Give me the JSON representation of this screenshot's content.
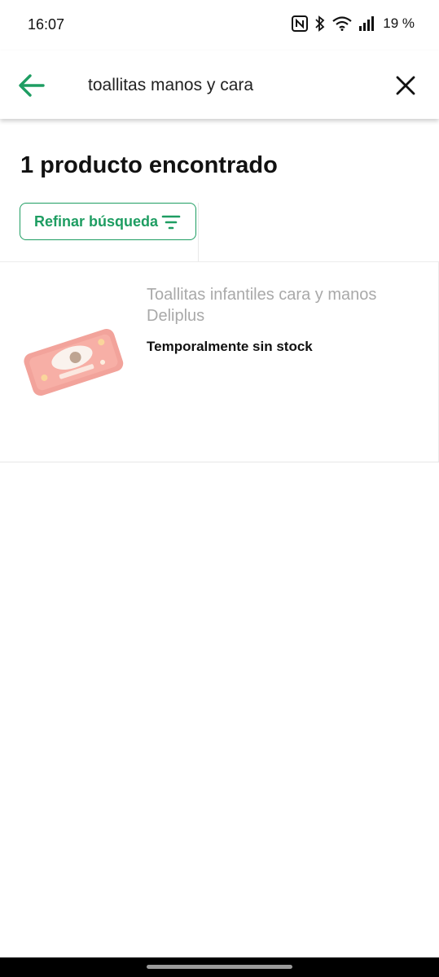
{
  "status_bar": {
    "time": "16:07",
    "battery": "19 %",
    "icons": [
      "nfc-icon",
      "bluetooth-icon",
      "wifi-icon",
      "signal-icon"
    ]
  },
  "search": {
    "query": "toallitas manos y cara",
    "back_icon": "arrow-left-icon",
    "clear_icon": "close-icon"
  },
  "results": {
    "title": "1 producto encontrado",
    "refine_label": "Refinar búsqueda",
    "refine_icon": "filter-icon"
  },
  "products": [
    {
      "name": "Toallitas infantiles cara y manos Deliplus",
      "stock_status": "Temporalmente sin stock"
    }
  ],
  "colors": {
    "accent": "#1e9d62",
    "muted_text": "#a9a9a9"
  }
}
